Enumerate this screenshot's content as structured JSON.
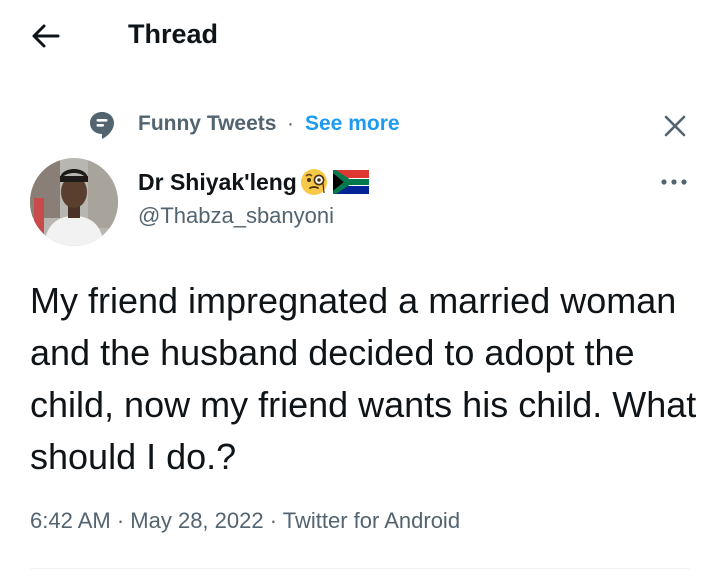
{
  "header": {
    "back_icon": "arrow-left-icon",
    "title": "Thread"
  },
  "context": {
    "topic_icon": "topic-bubble-icon",
    "topic_name": "Funny Tweets",
    "separator": "·",
    "see_more": "See more",
    "close_icon": "close-icon"
  },
  "author": {
    "display_name": "Dr Shiyak'leng",
    "emoji_icons": [
      "face-with-monocle-icon",
      "south-africa-flag-icon"
    ],
    "handle": "@Thabza_sbanyoni",
    "more_icon": "more-horizontal-icon"
  },
  "tweet": {
    "text": "My friend impregnated a married woman and the husband decided to adopt the child, now my friend wants his child. What should I do.?"
  },
  "meta": {
    "time": "6:42 AM",
    "sep1": " · ",
    "date": "May 28, 2022",
    "sep2": " · ",
    "source": "Twitter for Android"
  },
  "colors": {
    "text_primary": "#0f1419",
    "text_secondary": "#536471",
    "accent": "#1d9bf0",
    "divider": "#eff3f4"
  }
}
